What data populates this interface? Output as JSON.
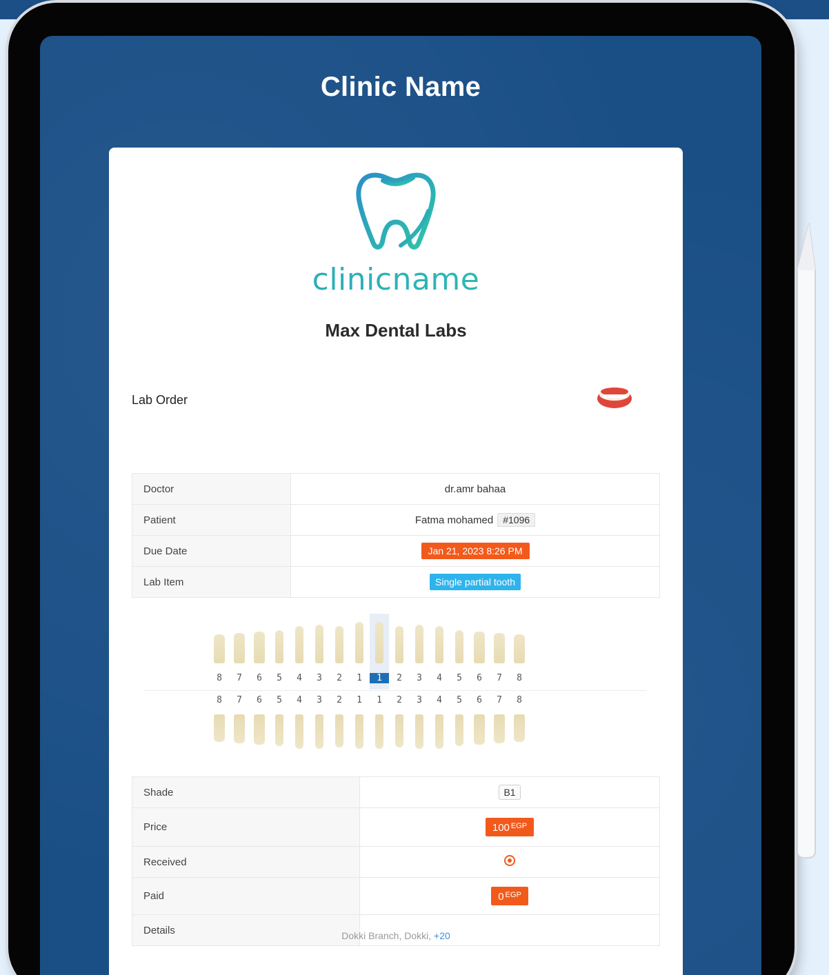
{
  "screen_title": "Clinic Name",
  "logo": {
    "text": "clinicname"
  },
  "lab_name": "Max Dental Labs",
  "order": {
    "title": "Lab Order",
    "doctor_label": "Doctor",
    "doctor_value": "dr.amr bahaa",
    "patient_label": "Patient",
    "patient_name": "Fatma mohamed",
    "patient_id": "#1096",
    "due_label": "Due Date",
    "due_value": "Jan 21, 2023 8:26 PM",
    "item_label": "Lab Item",
    "item_value": "Single partial tooth"
  },
  "teeth": {
    "upper_numbers": [
      "8",
      "7",
      "6",
      "5",
      "4",
      "3",
      "2",
      "1",
      "1",
      "2",
      "3",
      "4",
      "5",
      "6",
      "7",
      "8"
    ],
    "lower_numbers": [
      "8",
      "7",
      "6",
      "5",
      "4",
      "3",
      "2",
      "1",
      "1",
      "2",
      "3",
      "4",
      "5",
      "6",
      "7",
      "8"
    ],
    "selected": "upper-left-1"
  },
  "details": {
    "shade_label": "Shade",
    "shade_value": "B1",
    "price_label": "Price",
    "price_amount": "100",
    "price_currency": "EGP",
    "received_label": "Received",
    "paid_label": "Paid",
    "paid_amount": "0",
    "paid_currency": "EGP",
    "details_label": "Details",
    "details_value": ""
  },
  "footer": {
    "branch": "Dokki Branch,",
    "city": "Dokki,",
    "phone": "+20"
  },
  "colors": {
    "screen_bg": "#1a4f86",
    "accent_orange": "#f25a1c",
    "accent_blue": "#2fb3ec",
    "selected_tooth": "#1d6fb5"
  }
}
